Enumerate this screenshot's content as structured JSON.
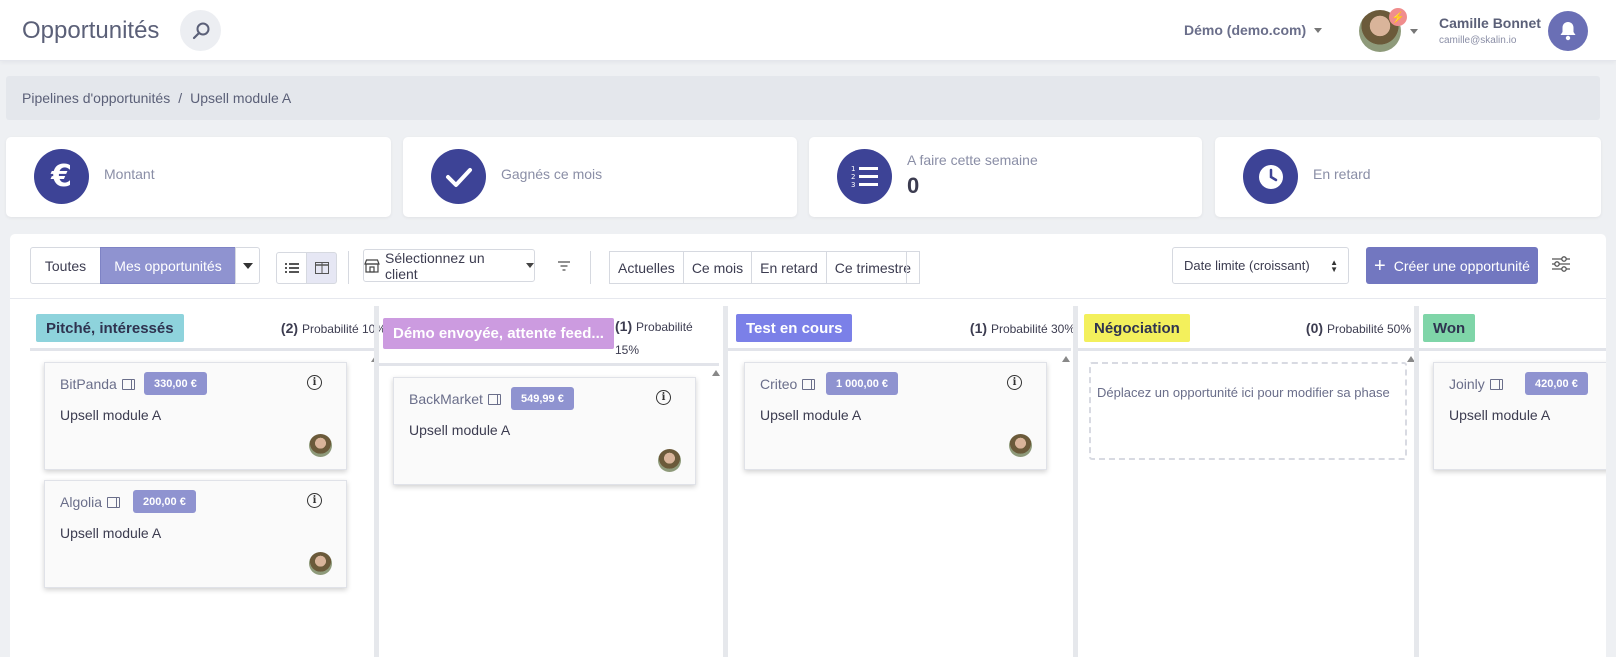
{
  "header": {
    "app_title": "Opportunités",
    "workspace": "Démo (demo.com)",
    "user_name": "Camille Bonnet",
    "user_email": "camille@skalin.io"
  },
  "breadcrumb": {
    "parent": "Pipelines d'opportunités",
    "separator": "/",
    "current": "Upsell module A"
  },
  "stats": [
    {
      "label": "Montant",
      "value": "",
      "icon": "euro-icon"
    },
    {
      "label": "Gagnés ce mois",
      "value": "",
      "icon": "check-icon"
    },
    {
      "label": "A faire cette semaine",
      "value": "0",
      "icon": "numbered-list-icon"
    },
    {
      "label": "En retard",
      "value": "",
      "icon": "clock-icon"
    }
  ],
  "toolbar": {
    "scope_all": "Toutes",
    "scope_mine": "Mes opportunités",
    "client_select": "Sélectionnez un client",
    "periods": [
      "Actuelles",
      "Ce mois",
      "En retard",
      "Ce trimestre"
    ],
    "sort": "Date limite (croissant)",
    "create": "Créer une opportunité"
  },
  "columns": [
    {
      "name": "Pitché, intéressés",
      "count": "(2)",
      "probability": "Probabilité 10%",
      "color": "#8ed3dc",
      "cards": [
        {
          "company": "BitPanda",
          "amount": "330,00 €",
          "title": "Upsell module A"
        },
        {
          "company": "Algolia",
          "amount": "200,00 €",
          "title": "Upsell module A"
        }
      ]
    },
    {
      "name": "Démo envoyée, attente feed...",
      "count": "(1)",
      "probability": "Probabilité 15%",
      "color": "#cc9be0",
      "cards": [
        {
          "company": "BackMarket",
          "amount": "549,99 €",
          "title": "Upsell module A"
        }
      ]
    },
    {
      "name": "Test en cours",
      "count": "(1)",
      "probability": "Probabilité 30%",
      "color": "#7b80e8",
      "cards": [
        {
          "company": "Criteo",
          "amount": "1 000,00 €",
          "title": "Upsell module A"
        }
      ]
    },
    {
      "name": "Négociation",
      "count": "(0)",
      "probability": "Probabilité 50%",
      "color": "#f3f05c",
      "empty_text": "Déplacez un opportunité ici pour modifier sa phase",
      "cards": []
    },
    {
      "name": "Won",
      "count": "",
      "probability": "",
      "color": "#7fd5a8",
      "cards": [
        {
          "company": "Joinly",
          "amount": "420,00 €",
          "title": "Upsell module A"
        }
      ]
    }
  ]
}
